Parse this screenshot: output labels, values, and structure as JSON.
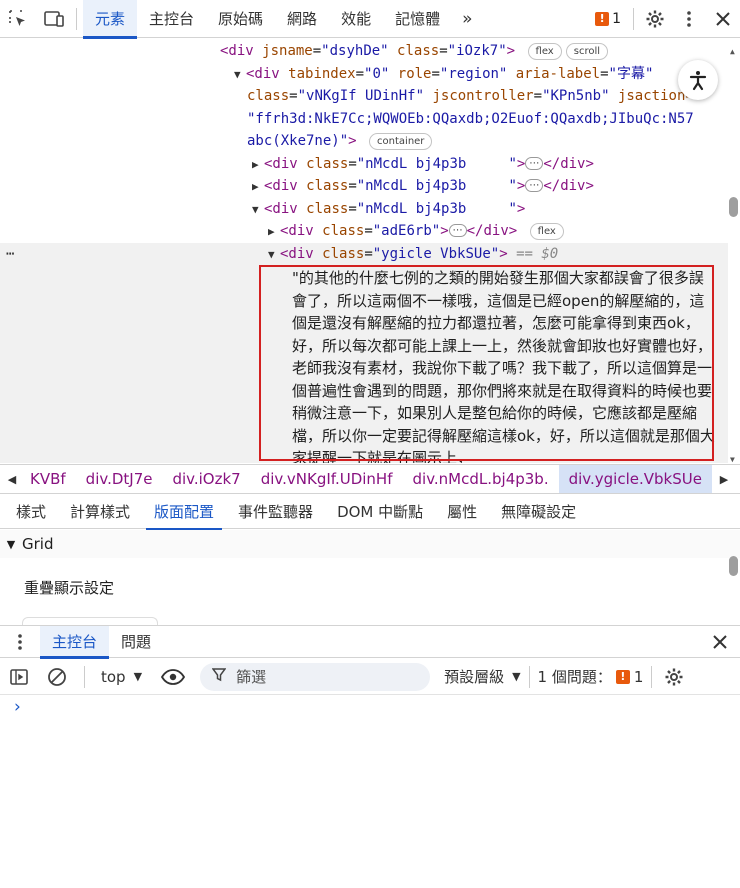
{
  "toolbar": {
    "tabs": [
      "元素",
      "主控台",
      "原始碼",
      "網路",
      "效能",
      "記憶體"
    ],
    "more": "»",
    "issue_count": "1"
  },
  "tree": {
    "l1": {
      "open": "<div",
      "a1": "jsname",
      "v1": "\"dsyhDe\"",
      "a2": "class",
      "v2": "\"iOzk7\"",
      "close": ">",
      "p1": "flex",
      "p2": "scroll"
    },
    "l2": {
      "open": "<div",
      "a1": "tabindex",
      "v1": "\"0\"",
      "a2": "role",
      "v2": "\"region\"",
      "a3": "aria-label",
      "v3": "\"字幕\""
    },
    "l3": {
      "a1": "class",
      "v1": "\"vNKgIf UDinHf\"",
      "a2": "jscontroller",
      "v2": "\"KPn5nb\"",
      "a3": "jsaction="
    },
    "l4": {
      "v": "\"ffrh3d:NkE7Cc;WQWOEb:QQaxdb;O2Euof:QQaxdb;JIbuQc:N57"
    },
    "l5": {
      "v": "abc(Xke7ne)\"",
      "close": ">",
      "pill": "container"
    },
    "l6": {
      "open": "<div",
      "a": "class",
      "v": "\"nMcdL bj4p3b     \"",
      "close": ">",
      "end": "</div>"
    },
    "l7": {
      "open": "<div",
      "a": "class",
      "v": "\"nMcdL bj4p3b     \"",
      "close": ">",
      "end": "</div>"
    },
    "l8": {
      "open": "<div",
      "a": "class",
      "v": "\"nMcdL bj4p3b     \"",
      "close": ">"
    },
    "l9": {
      "open": "<div",
      "a": "class",
      "v": "\"adE6rb\"",
      "close": ">",
      "end": "</div>",
      "pill": "flex"
    },
    "l10": {
      "open": "<div",
      "a": "class",
      "v": "\"ygicle VbkSUe\"",
      "close": ">",
      "eq": "== $0"
    },
    "caption_text": "\"的其他的什麼七例的之類的開始發生那個大家都誤會了很多誤會了，所以這兩個不一樣哦，這個是已經open的解壓縮的，這個是還沒有解壓縮的拉力都還拉著，怎麼可能拿得到東西ok，好，所以每次都可能上課上一上，然後就會卸妝也好實體也好，老師我沒有素材，我說你下載了嗎？我下載了，所以這個算是一個普遍性會遇到的問題，那你們將來就是在取得資料的時候也要稍微注意一下，如果別人是整包給你的時候，它應該都是壓縮檔，所以你一定要記得解壓縮這樣ok，好，所以這個就是那個大家提醒一下就是在圖示上，"
  },
  "breadcrumbs": [
    "KVBf",
    "div.DtJ7e",
    "div.iOzk7",
    "div.vNKgIf.UDinHf",
    "div.nMcdL.bj4p3b.",
    "div.ygicle.VbkSUe"
  ],
  "subtabs": [
    "樣式",
    "計算樣式",
    "版面配置",
    "事件監聽器",
    "DOM 中斷點",
    "屬性",
    "無障礙設定"
  ],
  "layout_panel": {
    "section": "Grid",
    "overlay_title": "重疊顯示設定"
  },
  "drawer": {
    "tabs": [
      "主控台",
      "問題"
    ]
  },
  "console": {
    "context": "top",
    "filter_placeholder": "篩選",
    "levels": "預設層級",
    "issues_label": "1 個問題：",
    "issues_count": "1",
    "prompt": "›"
  },
  "colors": {
    "accent": "#1a57c6",
    "tag": "#881280",
    "attr": "#994500",
    "value": "#1a1aa6",
    "highlight_box": "#d32020",
    "issue_flag": "#e8590c"
  }
}
